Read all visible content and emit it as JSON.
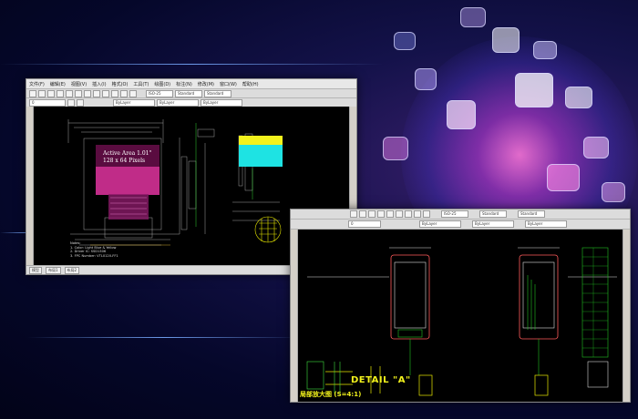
{
  "colors": {
    "accent": "#ff6ae0",
    "cyan": "#1ee3e3",
    "yellow": "#f2f21c",
    "magenta": "#c03090",
    "cad_bg": "#000000"
  },
  "cad_left": {
    "menu": [
      "文件(F)",
      "编辑(E)",
      "视图(V)",
      "插入(I)",
      "格式(O)",
      "工具(T)",
      "绘图(D)",
      "标注(N)",
      "修改(M)",
      "窗口(W)",
      "帮助(H)"
    ],
    "combo_layer": "0",
    "combo_style1": "ISO-25",
    "combo_style2": "Standard",
    "combo_style3": "Standard",
    "combo_bylayer1": "ByLayer",
    "combo_bylayer2": "ByLayer",
    "combo_bylayer3": "ByLayer",
    "drawing": {
      "active_area_line1": "Active Area 1.01\"",
      "active_area_line2": "128 x 64 Pixels",
      "notes_title": "Notes:",
      "notes": [
        "1. Color: Light Blue & Yellow",
        "2. Driver IC: SSD1306",
        "3. FPC Number: VTL0120-FF1"
      ]
    },
    "status_tabs": [
      "模型",
      "布局1",
      "布局2"
    ]
  },
  "cad_right": {
    "combo_layer": "0",
    "combo_style1": "ISO-25",
    "combo_style2": "Standard",
    "combo_style3": "Standard",
    "combo_bylayer1": "ByLayer",
    "combo_bylayer2": "ByLayer",
    "combo_bylayer3": "ByLayer",
    "drawing": {
      "detail_label": "DETAIL \"A\"",
      "cn_label": "局部放大图 (S=4:1)"
    }
  },
  "icons": [
    "new-file-icon",
    "open-icon",
    "save-icon",
    "print-icon",
    "undo-icon",
    "redo-icon",
    "zoom-icon",
    "pan-icon",
    "properties-icon"
  ]
}
